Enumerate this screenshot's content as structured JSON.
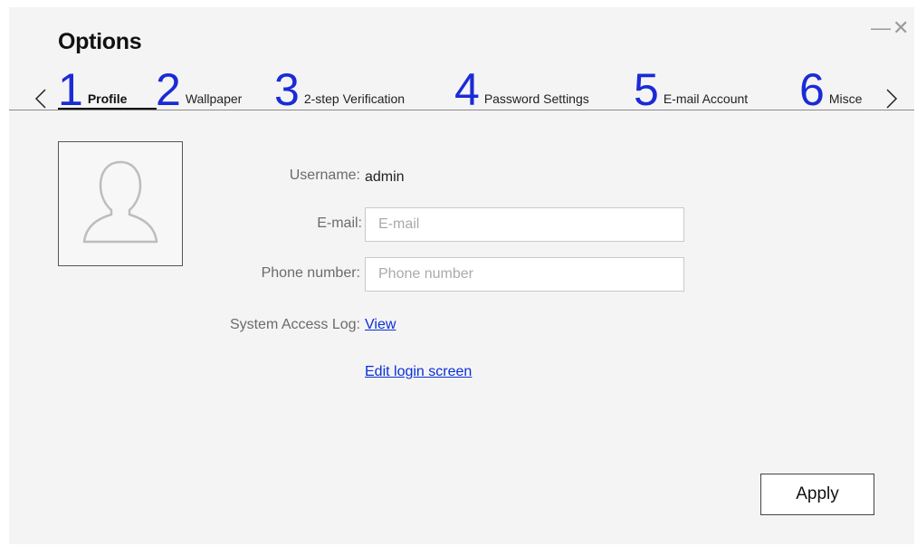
{
  "window": {
    "title": "Options",
    "minimize_glyph": "—",
    "close_glyph": "✕"
  },
  "tabs": [
    {
      "number": "1",
      "label": "Profile",
      "active": true
    },
    {
      "number": "2",
      "label": "Wallpaper",
      "active": false
    },
    {
      "number": "3",
      "label": "2-step Verification",
      "active": false
    },
    {
      "number": "4",
      "label": "Password Settings",
      "active": false
    },
    {
      "number": "5",
      "label": "E-mail Account",
      "active": false
    },
    {
      "number": "6",
      "label": "Miscellaneous",
      "active": false
    }
  ],
  "profile": {
    "avatar_icon": "user-silhouette-icon",
    "username_label": "Username:",
    "username_value": "admin",
    "email_label": "E-mail:",
    "email_value": "",
    "email_placeholder": "E-mail",
    "phone_label": "Phone number:",
    "phone_value": "",
    "phone_placeholder": "Phone number",
    "access_log_label": "System Access Log:",
    "access_log_link": "View",
    "edit_login_link": "Edit login screen"
  },
  "actions": {
    "apply_label": "Apply"
  },
  "colors": {
    "accent_number": "#1a2bd6",
    "link": "#0b2fd6",
    "window_bg": "#f4f4f4"
  }
}
